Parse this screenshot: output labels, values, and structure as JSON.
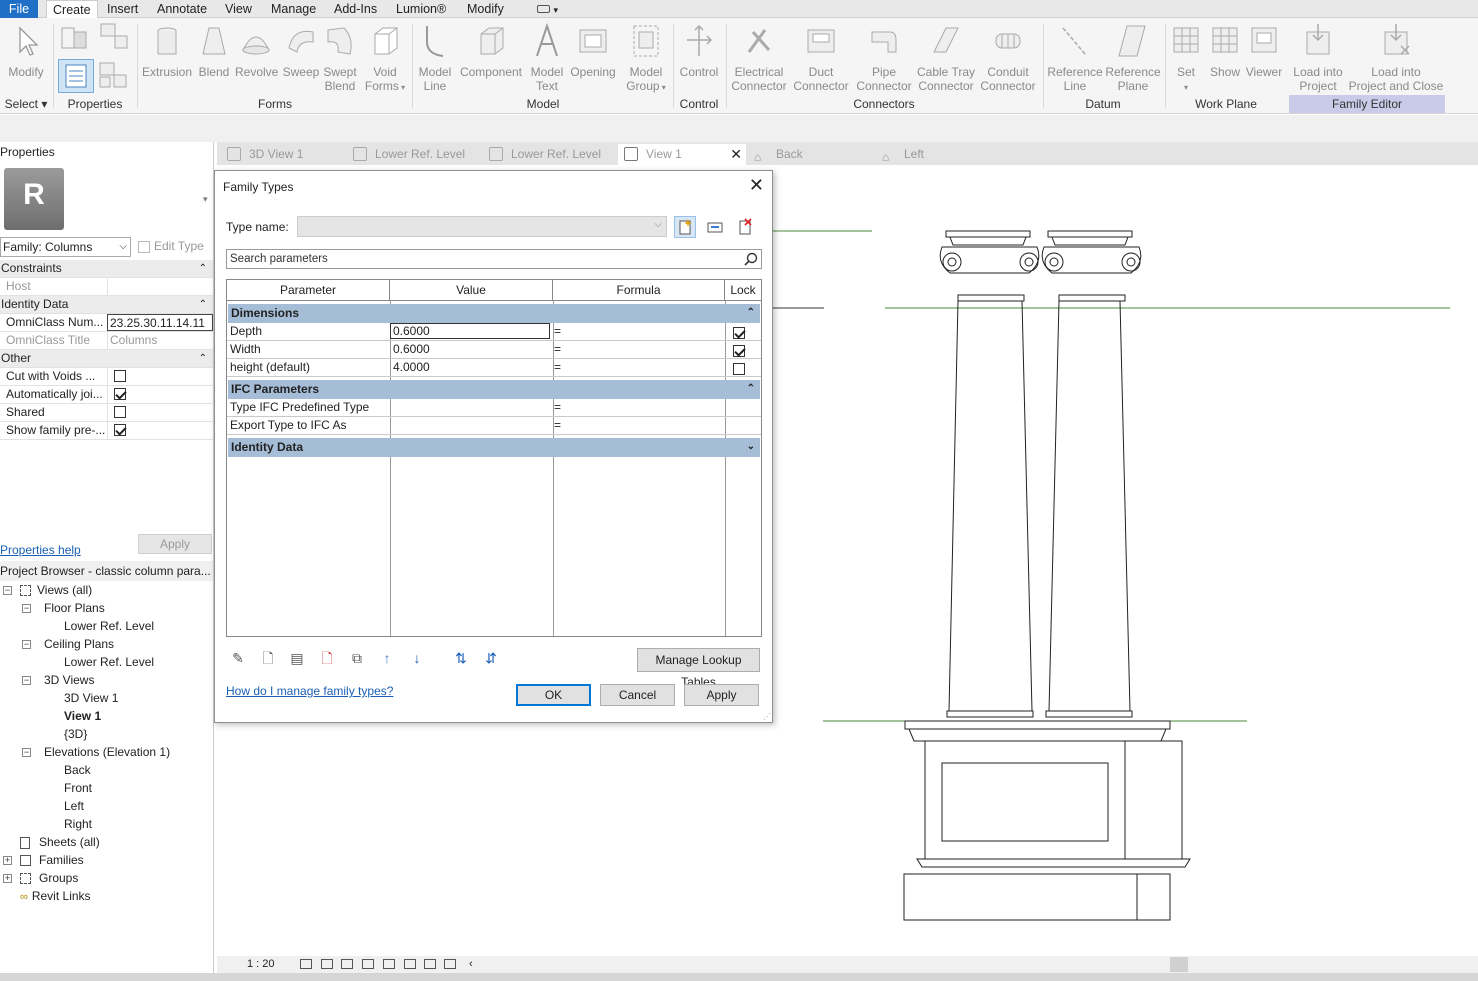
{
  "menubar": {
    "items": [
      "File",
      "Create",
      "Insert",
      "Annotate",
      "View",
      "Manage",
      "Add-Ins",
      "Lumion®",
      "Modify"
    ]
  },
  "ribbon": {
    "tools": {
      "modify": "Modify",
      "extrusion": "Extrusion",
      "blend": "Blend",
      "revolve": "Revolve",
      "sweep": "Sweep",
      "swept_blend_1": "Swept",
      "swept_blend_2": "Blend",
      "void_forms_1": "Void",
      "void_forms_2": "Forms",
      "model_line_1": "Model",
      "model_line_2": "Line",
      "component": "Component",
      "model_text_1": "Model",
      "model_text_2": "Text",
      "opening": "Opening",
      "model_group_1": "Model",
      "model_group_2": "Group",
      "control": "Control",
      "electrical_1": "Electrical",
      "electrical_2": "Connector",
      "duct_1": "Duct",
      "duct_2": "Connector",
      "pipe_1": "Pipe",
      "pipe_2": "Connector",
      "cable_1": "Cable Tray",
      "cable_2": "Connector",
      "conduit_1": "Conduit",
      "conduit_2": "Connector",
      "refline_1": "Reference",
      "refline_2": "Line",
      "refplane_1": "Reference",
      "refplane_2": "Plane",
      "set": "Set",
      "show": "Show",
      "viewer": "Viewer",
      "load_1": "Load into",
      "load_2": "Project",
      "loadclose_1": "Load into",
      "loadclose_2": "Project and Close"
    },
    "panels": {
      "select": "Select ▾",
      "properties": "Properties",
      "forms": "Forms",
      "model": "Model",
      "control": "Control",
      "connectors": "Connectors",
      "datum": "Datum",
      "work_plane": "Work Plane",
      "family_editor": "Family Editor"
    }
  },
  "properties": {
    "title": "Properties",
    "thumb_letter": "R",
    "family": "Family: Columns",
    "edit_type": "Edit Type",
    "rows": [
      {
        "type": "header",
        "label": "Constraints"
      },
      {
        "type": "row",
        "label": "Host",
        "value": "",
        "grey": true
      },
      {
        "type": "header",
        "label": "Identity Data"
      },
      {
        "type": "row",
        "label": "OmniClass Num...",
        "value": "23.25.30.11.14.11"
      },
      {
        "type": "row",
        "label": "OmniClass Title",
        "value": "Columns",
        "grey": true
      },
      {
        "type": "header",
        "label": "Other"
      },
      {
        "type": "check",
        "label": "Cut with Voids ...",
        "checked": false
      },
      {
        "type": "check",
        "label": "Automatically joi...",
        "checked": true
      },
      {
        "type": "check",
        "label": "Shared",
        "checked": false
      },
      {
        "type": "check",
        "label": "Show family pre-...",
        "checked": true
      }
    ],
    "help_link": "Properties help",
    "apply": "Apply"
  },
  "browser": {
    "title": "Project Browser - classic column para...",
    "views_all": "Views (all)",
    "floor_plans": "Floor Plans",
    "floor_lower": "Lower Ref. Level",
    "ceiling_plans": "Ceiling Plans",
    "ceiling_lower": "Lower Ref. Level",
    "views_3d": "3D Views",
    "view_3d_1": "3D View 1",
    "view_1": "View 1",
    "view_3d": "{3D}",
    "elevations": "Elevations (Elevation 1)",
    "elev_back": "Back",
    "elev_front": "Front",
    "elev_left": "Left",
    "elev_right": "Right",
    "sheets": "Sheets (all)",
    "families": "Families",
    "groups": "Groups",
    "revit_links": "Revit Links"
  },
  "tabs": [
    "3D View 1",
    "Lower Ref. Level",
    "Lower Ref. Level",
    "View 1",
    "Back",
    "Left"
  ],
  "status": {
    "scale": "1 : 20"
  },
  "dialog": {
    "title": "Family Types",
    "type_name_label": "Type name:",
    "search_placeholder": "Search parameters",
    "col_parameter": "Parameter",
    "col_value": "Value",
    "col_formula": "Formula",
    "col_lock": "Lock",
    "group_dimensions": "Dimensions",
    "depth_label": "Depth",
    "depth_value": "0.6000",
    "depth_formula": "=",
    "width_label": "Width",
    "width_value": "0.6000",
    "width_formula": "=",
    "height_label": "height (default)",
    "height_value": "4.0000",
    "height_formula": "=",
    "group_ifc": "IFC Parameters",
    "ifc_type_label": "Type IFC Predefined Type",
    "ifc_type_formula": "=",
    "ifc_export_label": "Export Type to IFC As",
    "ifc_export_formula": "=",
    "group_identity": "Identity Data",
    "manage_lookup": "Manage Lookup Tables",
    "help_link": "How do I manage family types?",
    "ok": "OK",
    "cancel": "Cancel",
    "apply": "Apply"
  }
}
